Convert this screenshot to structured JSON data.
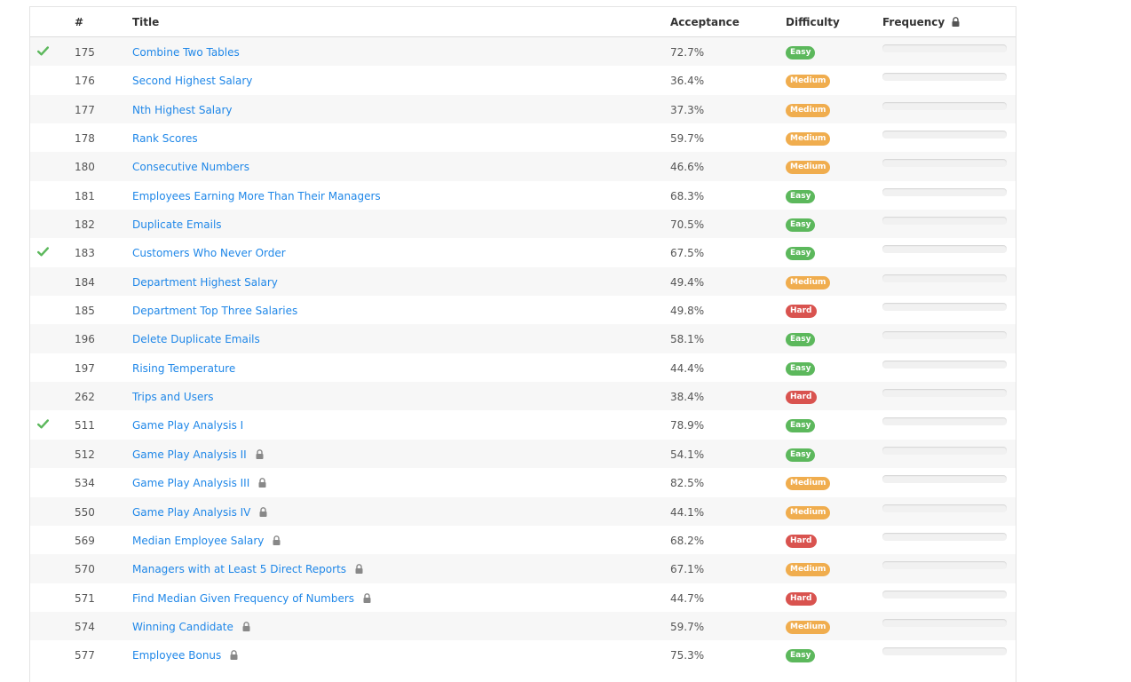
{
  "header": {
    "num": "#",
    "title": "Title",
    "acceptance": "Acceptance",
    "difficulty": "Difficulty",
    "frequency": "Frequency",
    "frequency_icon": "lock-icon"
  },
  "colors": {
    "link": "#1f87e8",
    "check": "#5cb85c",
    "easy": "#5cb85c",
    "medium": "#f0ad4e",
    "hard": "#d9534f",
    "lock": "#888888"
  },
  "rows": [
    {
      "solved": true,
      "num": "175",
      "title": "Combine Two Tables",
      "locked": false,
      "acceptance": "72.7%",
      "difficulty": "Easy"
    },
    {
      "solved": false,
      "num": "176",
      "title": "Second Highest Salary",
      "locked": false,
      "acceptance": "36.4%",
      "difficulty": "Medium"
    },
    {
      "solved": false,
      "num": "177",
      "title": "Nth Highest Salary",
      "locked": false,
      "acceptance": "37.3%",
      "difficulty": "Medium"
    },
    {
      "solved": false,
      "num": "178",
      "title": "Rank Scores",
      "locked": false,
      "acceptance": "59.7%",
      "difficulty": "Medium"
    },
    {
      "solved": false,
      "num": "180",
      "title": "Consecutive Numbers",
      "locked": false,
      "acceptance": "46.6%",
      "difficulty": "Medium"
    },
    {
      "solved": false,
      "num": "181",
      "title": "Employees Earning More Than Their Managers",
      "locked": false,
      "acceptance": "68.3%",
      "difficulty": "Easy"
    },
    {
      "solved": false,
      "num": "182",
      "title": "Duplicate Emails",
      "locked": false,
      "acceptance": "70.5%",
      "difficulty": "Easy"
    },
    {
      "solved": true,
      "num": "183",
      "title": "Customers Who Never Order",
      "locked": false,
      "acceptance": "67.5%",
      "difficulty": "Easy"
    },
    {
      "solved": false,
      "num": "184",
      "title": "Department Highest Salary",
      "locked": false,
      "acceptance": "49.4%",
      "difficulty": "Medium"
    },
    {
      "solved": false,
      "num": "185",
      "title": "Department Top Three Salaries",
      "locked": false,
      "acceptance": "49.8%",
      "difficulty": "Hard"
    },
    {
      "solved": false,
      "num": "196",
      "title": "Delete Duplicate Emails",
      "locked": false,
      "acceptance": "58.1%",
      "difficulty": "Easy"
    },
    {
      "solved": false,
      "num": "197",
      "title": "Rising Temperature",
      "locked": false,
      "acceptance": "44.4%",
      "difficulty": "Easy"
    },
    {
      "solved": false,
      "num": "262",
      "title": "Trips and Users",
      "locked": false,
      "acceptance": "38.4%",
      "difficulty": "Hard"
    },
    {
      "solved": true,
      "num": "511",
      "title": "Game Play Analysis I",
      "locked": false,
      "acceptance": "78.9%",
      "difficulty": "Easy"
    },
    {
      "solved": false,
      "num": "512",
      "title": "Game Play Analysis II",
      "locked": true,
      "acceptance": "54.1%",
      "difficulty": "Easy"
    },
    {
      "solved": false,
      "num": "534",
      "title": "Game Play Analysis III",
      "locked": true,
      "acceptance": "82.5%",
      "difficulty": "Medium"
    },
    {
      "solved": false,
      "num": "550",
      "title": "Game Play Analysis IV",
      "locked": true,
      "acceptance": "44.1%",
      "difficulty": "Medium"
    },
    {
      "solved": false,
      "num": "569",
      "title": "Median Employee Salary",
      "locked": true,
      "acceptance": "68.2%",
      "difficulty": "Hard"
    },
    {
      "solved": false,
      "num": "570",
      "title": "Managers with at Least 5 Direct Reports",
      "locked": true,
      "acceptance": "67.1%",
      "difficulty": "Medium"
    },
    {
      "solved": false,
      "num": "571",
      "title": "Find Median Given Frequency of Numbers",
      "locked": true,
      "acceptance": "44.7%",
      "difficulty": "Hard"
    },
    {
      "solved": false,
      "num": "574",
      "title": "Winning Candidate",
      "locked": true,
      "acceptance": "59.7%",
      "difficulty": "Medium"
    },
    {
      "solved": false,
      "num": "577",
      "title": "Employee Bonus",
      "locked": true,
      "acceptance": "75.3%",
      "difficulty": "Easy"
    }
  ]
}
